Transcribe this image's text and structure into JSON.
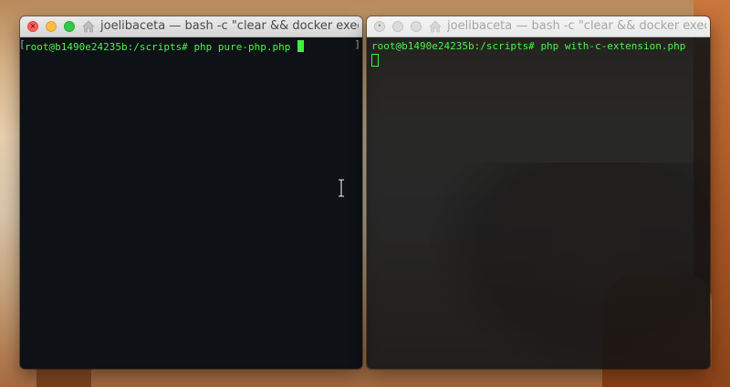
{
  "windows": {
    "left": {
      "title": "joelibaceta — bash -c \"clear && docker exec -i...",
      "prompt": "root@b1490e24235b:/scripts# ",
      "command": "php pure-php.php"
    },
    "right": {
      "title": "joelibaceta — bash -c \"clear && docker exec -i...",
      "prompt": "root@b1490e24235b:/scripts# ",
      "command": "php with-c-extension.php"
    }
  },
  "brackets": {
    "left": "[",
    "right": "]"
  },
  "colors": {
    "terminal_bg": "#0e1115",
    "terminal_text": "#4cf24c",
    "close": "#fc605c",
    "minimize": "#fdbc40",
    "zoom": "#34c84a"
  },
  "icons": {
    "home": "home-icon",
    "text_cursor": "ibeam-cursor-icon"
  }
}
